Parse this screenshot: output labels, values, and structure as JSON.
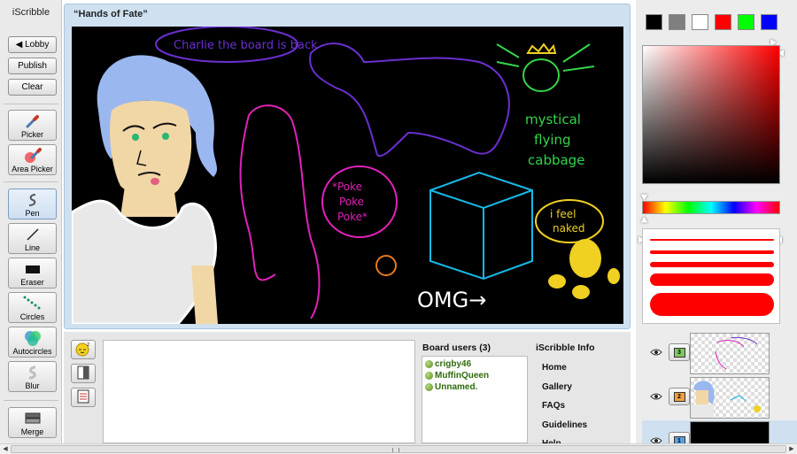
{
  "app": {
    "title": "iScribble"
  },
  "toolbar": {
    "lobby": "◀ Lobby",
    "publish": "Publish",
    "clear": "Clear",
    "tools": [
      {
        "label": "Picker",
        "icon": "picker-icon"
      },
      {
        "label": "Area Picker",
        "icon": "area-picker-icon"
      },
      {
        "label": "Pen",
        "icon": "pen-icon",
        "active": true
      },
      {
        "label": "Line",
        "icon": "line-icon"
      },
      {
        "label": "Eraser",
        "icon": "eraser-icon"
      },
      {
        "label": "Circles",
        "icon": "circles-icon"
      },
      {
        "label": "Autocircles",
        "icon": "autocircles-icon"
      },
      {
        "label": "Blur",
        "icon": "blur-icon"
      },
      {
        "label": "Merge",
        "icon": "merge-icon"
      }
    ]
  },
  "board": {
    "title": "“Hands of Fate”",
    "drawing_texts": {
      "bubble_top": "Charlie the board is back",
      "cabbage": [
        "mystical",
        "flying",
        "cabbage"
      ],
      "poke": [
        "*Poke",
        "Poke",
        "Poke*"
      ],
      "naked": [
        "i feel",
        "naked"
      ],
      "omg": "OMG→"
    }
  },
  "chat": {
    "message": ""
  },
  "users": {
    "title": "Board users (3)",
    "list": [
      "crigby46",
      "MuffinQueen",
      "Unnamed."
    ]
  },
  "info": {
    "title": "iScribble Info",
    "links": [
      "Home",
      "Gallery",
      "FAQs",
      "Guidelines",
      "Help"
    ]
  },
  "colors": {
    "palette": [
      "#000000",
      "#7f7f7f",
      "#ffffff",
      "#ff0000",
      "#00ff00",
      "#0000ff"
    ],
    "current": "#ff0000"
  },
  "brush": {
    "sizes_count": 5,
    "selected": 5
  },
  "layers": [
    {
      "number": "3"
    },
    {
      "number": "2"
    },
    {
      "number": "1"
    }
  ]
}
